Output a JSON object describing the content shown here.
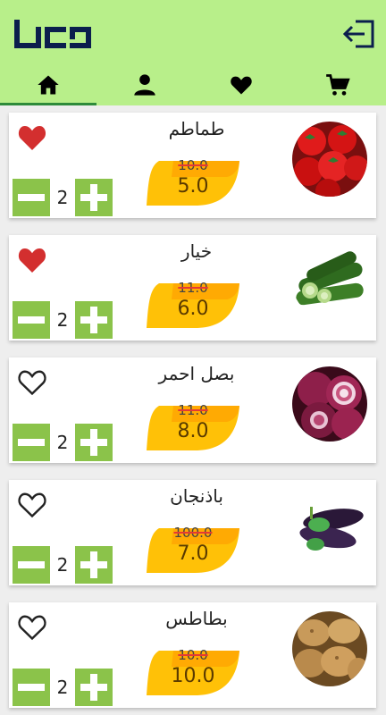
{
  "header": {
    "logo_text": "لدنا",
    "tabs": [
      {
        "icon": "home-icon",
        "active": true
      },
      {
        "icon": "person-icon",
        "active": false
      },
      {
        "icon": "heart-icon",
        "active": false
      },
      {
        "icon": "cart-icon",
        "active": false
      }
    ]
  },
  "products": [
    {
      "name": "طماطم",
      "old_price": "10.0",
      "price": "5.0",
      "qty": "2",
      "favorite": true,
      "image": "tomatoes"
    },
    {
      "name": "خيار",
      "old_price": "11.0",
      "price": "6.0",
      "qty": "2",
      "favorite": true,
      "image": "cucumbers"
    },
    {
      "name": "بصل احمر",
      "old_price": "11.0",
      "price": "8.0",
      "qty": "2",
      "favorite": false,
      "image": "red-onions"
    },
    {
      "name": "باذنجان",
      "old_price": "100.0",
      "price": "7.0",
      "qty": "2",
      "favorite": false,
      "image": "eggplants"
    },
    {
      "name": "بطاطس",
      "old_price": "10.0",
      "price": "10.0",
      "qty": "2",
      "favorite": false,
      "image": "potatoes"
    }
  ],
  "colors": {
    "header_bg": "#b8ef8a",
    "accent_green": "#8bc34a",
    "price_tag": "#ffc107",
    "favorite_red": "#d32f2f"
  }
}
